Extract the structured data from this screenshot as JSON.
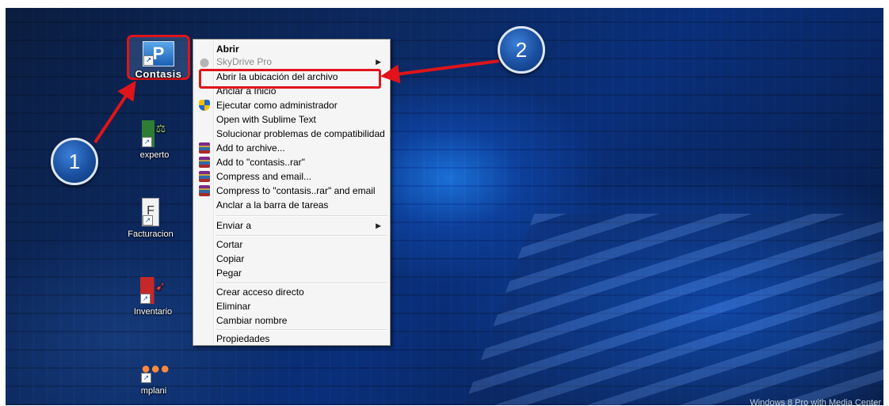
{
  "desktop_icons": {
    "contasis": {
      "label": "Contasis",
      "glyph": "P"
    },
    "experto": {
      "label": "experto"
    },
    "facturacion": {
      "label": "Facturacion"
    },
    "inventario": {
      "label": "Inventario"
    },
    "mplani": {
      "label": "mplani"
    }
  },
  "context_menu": {
    "items": [
      {
        "label": "Abrir"
      },
      {
        "label": "SkyDrive Pro",
        "icon": "skydrive-icon"
      },
      {
        "label": "Abrir la ubicación del archivo"
      },
      {
        "label": "Anclar a Inicio"
      },
      {
        "label": "Ejecutar como administrador",
        "icon": "uac-shield-icon"
      },
      {
        "label": "Open with Sublime Text"
      },
      {
        "label": "Solucionar problemas de compatibilidad"
      },
      {
        "label": "Add to archive...",
        "icon": "winrar-icon"
      },
      {
        "label": "Add to \"contasis..rar\"",
        "icon": "winrar-icon"
      },
      {
        "label": "Compress and email...",
        "icon": "winrar-icon"
      },
      {
        "label": "Compress to \"contasis..rar\" and email",
        "icon": "winrar-icon"
      },
      {
        "label": "Anclar a la barra de tareas"
      },
      {
        "label": "Enviar a"
      },
      {
        "label": "Cortar"
      },
      {
        "label": "Copiar"
      },
      {
        "label": "Pegar"
      },
      {
        "label": "Crear acceso directo"
      },
      {
        "label": "Eliminar"
      },
      {
        "label": "Cambiar nombre"
      },
      {
        "label": "Propiedades"
      }
    ]
  },
  "annotations": {
    "badge_1": "1",
    "badge_2": "2",
    "highlight_color": "#e0141a"
  },
  "watermark": "Windows 8 Pro with Media Center"
}
